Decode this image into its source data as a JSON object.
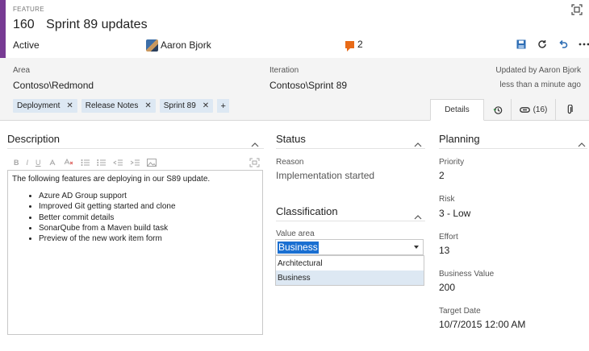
{
  "header": {
    "type_label": "FEATURE",
    "id": "160",
    "title": "Sprint 89 updates",
    "state": "Active",
    "assigned_to": "Aaron Bjork",
    "comment_count": "2",
    "accent_color": "#773b93"
  },
  "toolbar": {
    "icons": [
      "save-icon",
      "refresh-icon",
      "undo-icon",
      "more-icon"
    ]
  },
  "fields": {
    "area_label": "Area",
    "area_value": "Contoso\\Redmond",
    "iteration_label": "Iteration",
    "iteration_value": "Contoso\\Sprint 89",
    "updated_by": "Updated by Aaron Bjork",
    "updated_when": "less than a minute ago"
  },
  "tags": [
    {
      "label": "Deployment"
    },
    {
      "label": "Release Notes"
    },
    {
      "label": "Sprint 89"
    }
  ],
  "tag_add": "+",
  "tabs": {
    "details": "Details",
    "links_count": "(16)"
  },
  "description": {
    "title": "Description",
    "intro": "The following features are deploying in our S89 update.",
    "items": [
      "Azure AD Group support",
      "Improved Git getting started and clone",
      "Better commit details",
      "SonarQube from a Maven build task",
      "Preview of the new work item form"
    ],
    "toolbar_bold": "B",
    "toolbar_italic": "I",
    "toolbar_underline": "U"
  },
  "status": {
    "title": "Status",
    "reason_label": "Reason",
    "reason_value": "Implementation started"
  },
  "classification": {
    "title": "Classification",
    "value_area_label": "Value area",
    "value_area_selected": "Business",
    "options": [
      "Architectural",
      "Business"
    ]
  },
  "planning": {
    "title": "Planning",
    "priority_label": "Priority",
    "priority_value": "2",
    "risk_label": "Risk",
    "risk_value": "3 - Low",
    "effort_label": "Effort",
    "effort_value": "13",
    "business_value_label": "Business Value",
    "business_value_value": "200",
    "target_date_label": "Target Date",
    "target_date_value": "10/7/2015 12:00 AM"
  }
}
